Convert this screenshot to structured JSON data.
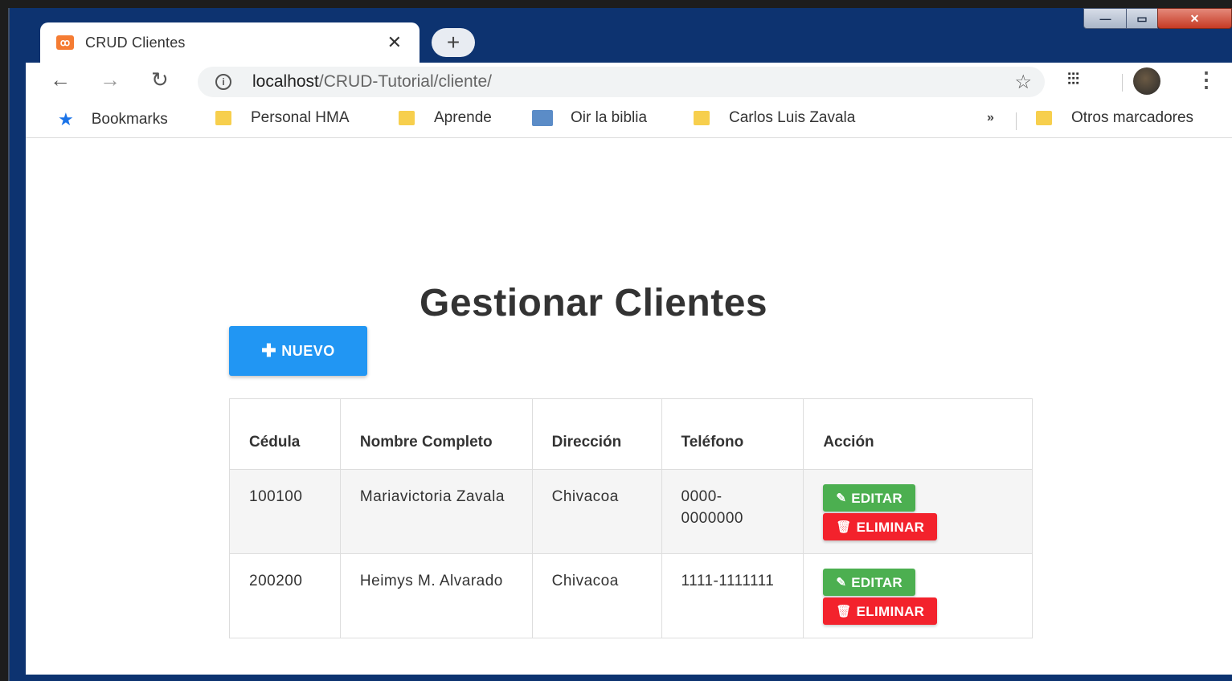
{
  "browser": {
    "tab_title": "CRUD Clientes",
    "tab_close": "✕",
    "new_tab": "+",
    "url_host": "localhost",
    "url_path": "/CRUD-Tutorial/cliente/",
    "bookmarks": [
      "Bookmarks",
      "Personal HMA",
      "Aprende",
      "Oir la biblia",
      "Carlos Luis Zavala"
    ],
    "bookmarks_overflow": "»",
    "other_bookmarks": "Otros marcadores"
  },
  "page": {
    "title": "Gestionar Clientes",
    "new_button": "NUEVO"
  },
  "table": {
    "headers": [
      "Cédula",
      "Nombre Completo",
      "Dirección",
      "Teléfono",
      "Acción"
    ],
    "rows": [
      {
        "cedula": "100100",
        "nombre": "Mariavictoria Zavala",
        "direccion": "Chivacoa",
        "telefono": "0000-0000000"
      },
      {
        "cedula": "200200",
        "nombre": "Heimys M. Alvarado",
        "direccion": "Chivacoa",
        "telefono": "1111-1111111"
      }
    ],
    "edit_label": "EDITAR",
    "delete_label": "ELIMINAR"
  }
}
